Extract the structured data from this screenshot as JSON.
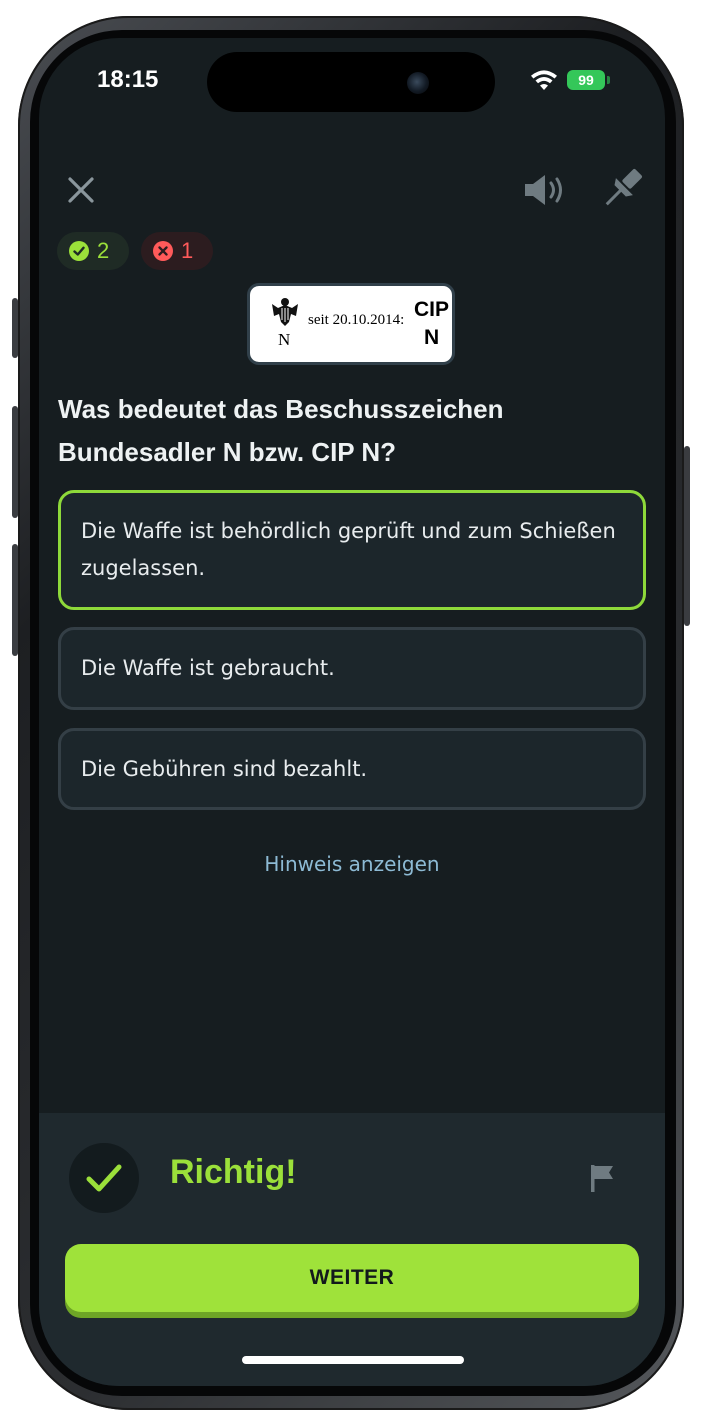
{
  "status_bar": {
    "time": "18:15",
    "battery": "99"
  },
  "toolbar": {
    "close_icon": "close-icon",
    "sound_icon": "speaker-icon",
    "pin_icon": "pin-icon"
  },
  "score": {
    "correct": "2",
    "wrong": "1",
    "correct_color": "#9be03a",
    "wrong_color": "#ff5a5a"
  },
  "image": {
    "since": "seit 20.10.2014:",
    "cip": "CIP",
    "n_left": "N",
    "n_right": "N"
  },
  "question": "Was bedeutet das Beschusszeichen Bundesadler N bzw. CIP N?",
  "answers": [
    {
      "text": "Die Waffe ist behördlich geprüft und zum Schießen zugelassen.",
      "selected": true
    },
    {
      "text": "Die Waffe ist gebraucht.",
      "selected": false
    },
    {
      "text": "Die Gebühren sind bezahlt.",
      "selected": false
    }
  ],
  "hint_link": "Hinweis anzeigen",
  "result": {
    "label": "Richtig!",
    "continue_label": "WEITER",
    "accent": "#9fe23a"
  }
}
